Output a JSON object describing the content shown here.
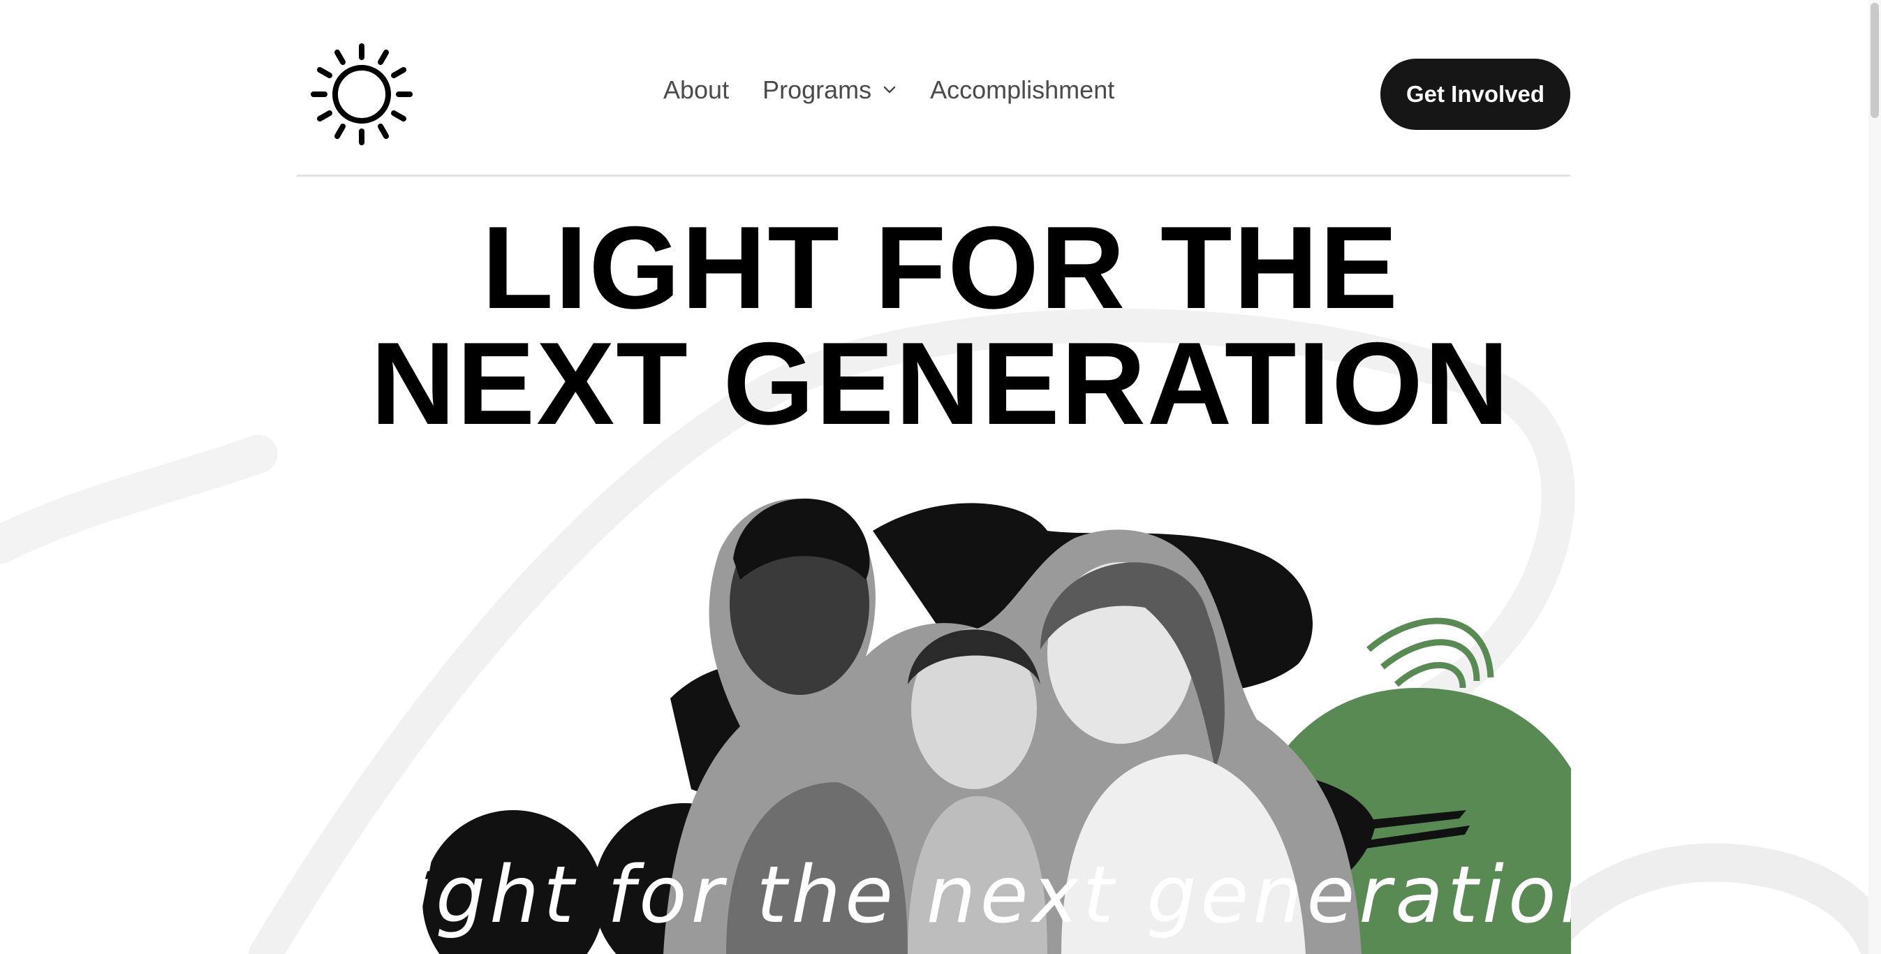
{
  "nav": {
    "items": [
      {
        "label": "About"
      },
      {
        "label": "Programs",
        "has_dropdown": true
      },
      {
        "label": "Accomplishment"
      }
    ],
    "cta_label": "Get Involved"
  },
  "hero": {
    "title_line1": "LIGHT FOR THE",
    "title_line2": "NEXT GENERATION",
    "script_text": "Light for the next generation"
  },
  "icons": {
    "logo": "sun-icon",
    "dropdown": "chevron-down-icon"
  },
  "colors": {
    "accent_green": "#5a8a54",
    "cta_bg": "#161616",
    "text": "#111111"
  }
}
